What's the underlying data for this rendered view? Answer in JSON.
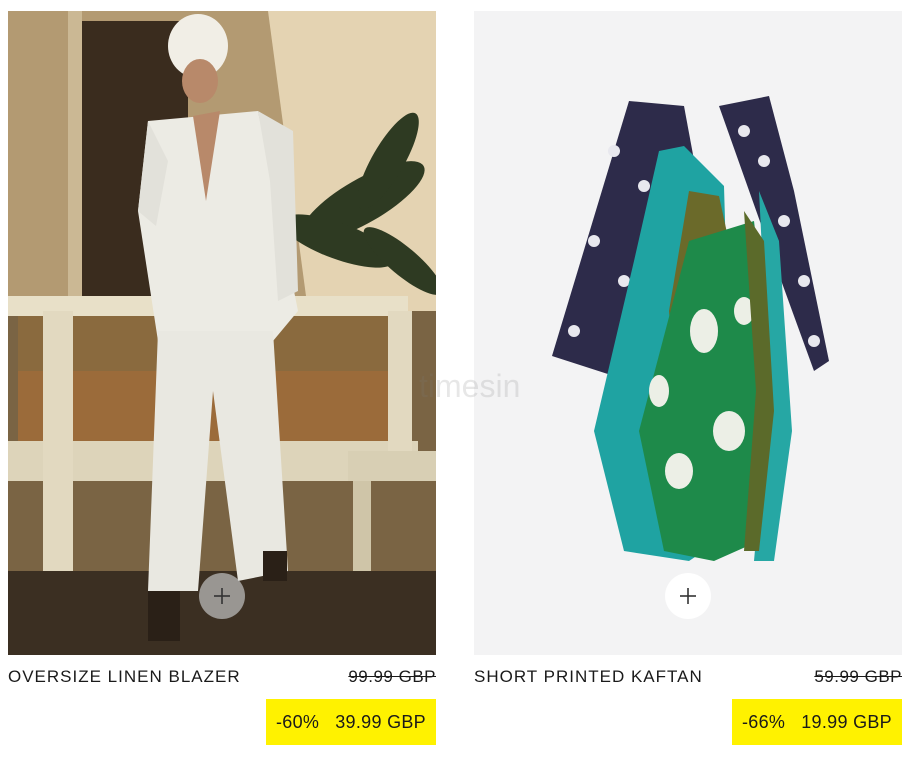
{
  "products": [
    {
      "name": "OVERSIZE LINEN BLAZER",
      "old_price": "99.99 GBP",
      "discount": "-60%",
      "sale_price": "39.99 GBP"
    },
    {
      "name": "SHORT PRINTED KAFTAN",
      "old_price": "59.99 GBP",
      "discount": "-66%",
      "sale_price": "19.99 GBP"
    }
  ],
  "watermark": "timesin",
  "icons": {
    "add": "plus-icon"
  },
  "colors": {
    "sale_badge": "#fff200",
    "text": "#1a1a1a"
  }
}
